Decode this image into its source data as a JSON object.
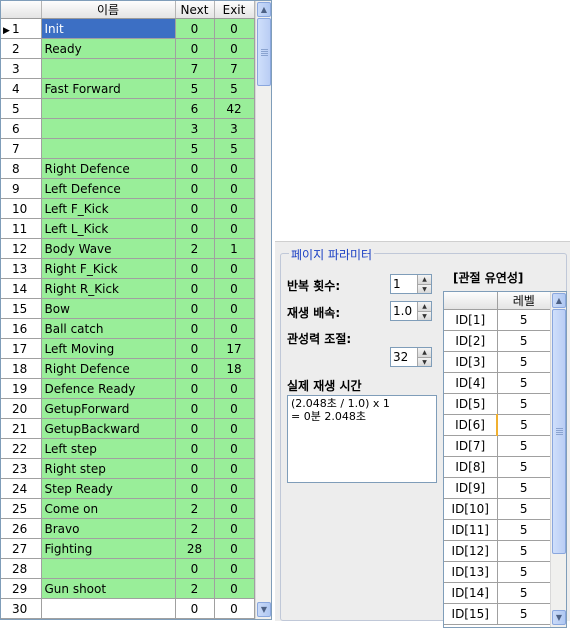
{
  "grid": {
    "headers": {
      "name": "이름",
      "next": "Next",
      "exit": "Exit"
    },
    "current_row_marker": "▶",
    "rows": [
      {
        "no": "1",
        "name": "Init",
        "next": "0",
        "exit": "0"
      },
      {
        "no": "2",
        "name": "Ready",
        "next": "0",
        "exit": "0"
      },
      {
        "no": "3",
        "name": "",
        "next": "7",
        "exit": "7"
      },
      {
        "no": "4",
        "name": "Fast Forward",
        "next": "5",
        "exit": "5"
      },
      {
        "no": "5",
        "name": "",
        "next": "6",
        "exit": "42"
      },
      {
        "no": "6",
        "name": "",
        "next": "3",
        "exit": "3"
      },
      {
        "no": "7",
        "name": "",
        "next": "5",
        "exit": "5"
      },
      {
        "no": "8",
        "name": "Right Defence",
        "next": "0",
        "exit": "0"
      },
      {
        "no": "9",
        "name": "Left Defence",
        "next": "0",
        "exit": "0"
      },
      {
        "no": "10",
        "name": "Left F_Kick",
        "next": "0",
        "exit": "0"
      },
      {
        "no": "11",
        "name": "Left L_Kick",
        "next": "0",
        "exit": "0"
      },
      {
        "no": "12",
        "name": "Body Wave",
        "next": "2",
        "exit": "1"
      },
      {
        "no": "13",
        "name": "Right F_Kick",
        "next": "0",
        "exit": "0"
      },
      {
        "no": "14",
        "name": "Right R_Kick",
        "next": "0",
        "exit": "0"
      },
      {
        "no": "15",
        "name": "Bow",
        "next": "0",
        "exit": "0"
      },
      {
        "no": "16",
        "name": "Ball catch",
        "next": "0",
        "exit": "0"
      },
      {
        "no": "17",
        "name": "Left Moving",
        "next": "0",
        "exit": "17"
      },
      {
        "no": "18",
        "name": "Right Defence",
        "next": "0",
        "exit": "18"
      },
      {
        "no": "19",
        "name": "Defence Ready",
        "next": "0",
        "exit": "0"
      },
      {
        "no": "20",
        "name": "GetupForward",
        "next": "0",
        "exit": "0"
      },
      {
        "no": "21",
        "name": "GetupBackward",
        "next": "0",
        "exit": "0"
      },
      {
        "no": "22",
        "name": "Left step",
        "next": "0",
        "exit": "0"
      },
      {
        "no": "23",
        "name": "Right step",
        "next": "0",
        "exit": "0"
      },
      {
        "no": "24",
        "name": "Step Ready",
        "next": "0",
        "exit": "0"
      },
      {
        "no": "25",
        "name": "Come on",
        "next": "2",
        "exit": "0"
      },
      {
        "no": "26",
        "name": "Bravo",
        "next": "2",
        "exit": "0"
      },
      {
        "no": "27",
        "name": "Fighting",
        "next": "28",
        "exit": "0"
      },
      {
        "no": "28",
        "name": "",
        "next": "0",
        "exit": "0"
      },
      {
        "no": "29",
        "name": "Gun shoot",
        "next": "2",
        "exit": "0"
      },
      {
        "no": "30",
        "name": "",
        "next": "0",
        "exit": "0"
      }
    ]
  },
  "page_params": {
    "group_title": "페이지 파라미터",
    "repeat_label": "반복 횟수:",
    "repeat_value": "1",
    "speed_label": "재생 배속:",
    "speed_value": "1.0",
    "inertia_label": "관성력 조절:",
    "inertia_value": "32",
    "playtime_label": "실제 재생 시간",
    "playtime_text": "(2.048초 / 1.0) x 1\n= 0분 2.048초",
    "joint_title": "[관절 유연성]",
    "level_header": "레벨",
    "joints": [
      {
        "id": "ID[1]",
        "level": "5"
      },
      {
        "id": "ID[2]",
        "level": "5"
      },
      {
        "id": "ID[3]",
        "level": "5"
      },
      {
        "id": "ID[4]",
        "level": "5"
      },
      {
        "id": "ID[5]",
        "level": "5"
      },
      {
        "id": "ID[6]",
        "level": "5"
      },
      {
        "id": "ID[7]",
        "level": "5"
      },
      {
        "id": "ID[8]",
        "level": "5"
      },
      {
        "id": "ID[9]",
        "level": "5"
      },
      {
        "id": "ID[10]",
        "level": "5"
      },
      {
        "id": "ID[11]",
        "level": "5"
      },
      {
        "id": "ID[12]",
        "level": "5"
      },
      {
        "id": "ID[13]",
        "level": "5"
      },
      {
        "id": "ID[14]",
        "level": "5"
      },
      {
        "id": "ID[15]",
        "level": "5"
      }
    ]
  },
  "colors": {
    "row_fill": "#99ee99",
    "selection": "#3c6fc4",
    "group_title": "#1a3fc4",
    "active_marker": "#f0b030"
  },
  "icons": {
    "scroll_up": "▲",
    "scroll_down": "▼",
    "spin_up": "▲",
    "spin_down": "▼"
  }
}
